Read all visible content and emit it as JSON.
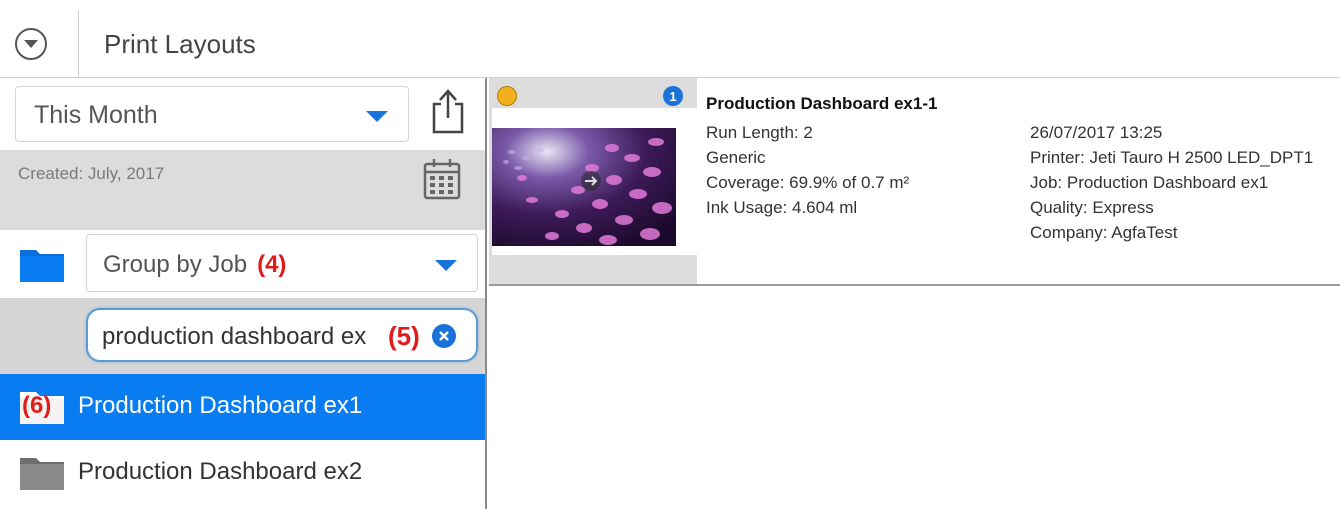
{
  "header": {
    "title": "Print Layouts"
  },
  "sidebar": {
    "period": {
      "selected": "This Month"
    },
    "created_label": "Created: July, 2017",
    "grouping": {
      "selected": "Group by Job",
      "annotation": "(4)"
    },
    "search": {
      "value": "production dashboard ex",
      "annotation": "(5)"
    },
    "jobs": [
      {
        "label": "Production Dashboard ex1",
        "selected": true,
        "annotation": "(6)"
      },
      {
        "label": "Production Dashboard ex2",
        "selected": false
      }
    ]
  },
  "layouts": [
    {
      "title": "Production Dashboard ex1-1",
      "badge_count": "1",
      "status_color": "#f2b01e",
      "left_details": [
        "Run Length: 2",
        "Generic",
        "Coverage: 69.9% of 0.7 m²",
        "Ink Usage: 4.604 ml"
      ],
      "right_details": [
        "26/07/2017 13:25",
        "Printer: Jeti Tauro H 2500 LED_DPT1",
        "Job: Production Dashboard ex1",
        "Quality: Express",
        "Company: AgfaTest"
      ]
    }
  ],
  "colors": {
    "accent": "#1a73d9",
    "selected_row": "#0a7cf2",
    "annotation": "#e11c1c"
  },
  "icons": [
    "chevron-down-circle-icon",
    "export-icon",
    "calendar-icon",
    "folder-icon",
    "clear-icon",
    "arrow-right-icon"
  ]
}
